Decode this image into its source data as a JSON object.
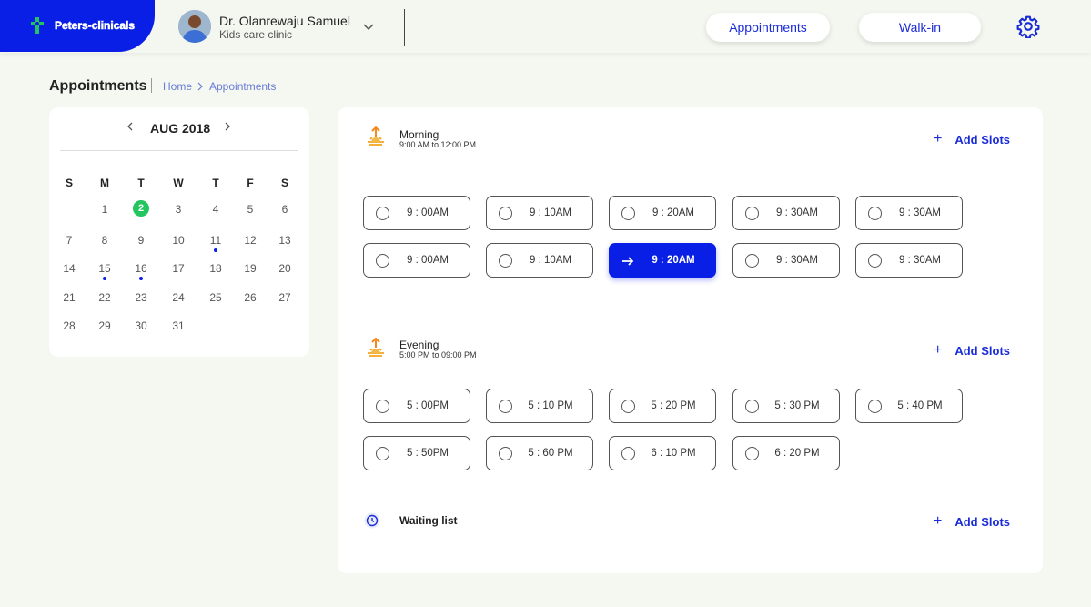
{
  "header": {
    "brand_name": "Peters-clinicals",
    "doctor_name": "Dr. Olanrewaju Samuel",
    "clinic_name": "Kids care clinic",
    "nav_appointments": "Appointments",
    "nav_walkin": "Walk-in",
    "brand_color": "#0a1fe6"
  },
  "page": {
    "title": "Appointments",
    "breadcrumb": [
      "Home",
      "Appointments"
    ]
  },
  "calendar": {
    "month": "AUG 2018",
    "weekdays": [
      "S",
      "M",
      "T",
      "W",
      "T",
      "F",
      "S"
    ],
    "weeks": [
      [
        "",
        "1",
        "2",
        "3",
        "4",
        "5",
        "6"
      ],
      [
        "7",
        "8",
        "9",
        "10",
        "11",
        "12",
        "13"
      ],
      [
        "14",
        "15",
        "16",
        "17",
        "18",
        "19",
        "20"
      ],
      [
        "21",
        "22",
        "23",
        "24",
        "25",
        "26",
        "27"
      ],
      [
        "28",
        "29",
        "30",
        "31",
        "",
        "",
        ""
      ]
    ],
    "selected_day": "2",
    "marked_days": [
      "11",
      "15",
      "16"
    ],
    "selected_color": "#22c55e"
  },
  "sections": {
    "morning": {
      "title": "Morning",
      "subtitle": "9:00 AM to 12:00 PM",
      "add_label": "Add Slots",
      "slots": [
        "9 : 00AM",
        "9 : 10AM",
        "9 : 20AM",
        "9 : 30AM",
        "9 : 30AM",
        "9 : 00AM",
        "9 : 10AM",
        "9 : 20AM",
        "9 : 30AM",
        "9 : 30AM"
      ],
      "active_index": 7
    },
    "evening": {
      "title": "Evening",
      "subtitle": "5:00 PM to 09:00 PM",
      "add_label": "Add Slots",
      "slots": [
        "5 : 00PM",
        "5 : 10 PM",
        "5 : 20 PM",
        "5 : 30 PM",
        "5 : 40 PM",
        "5 : 50PM",
        "5 : 60 PM",
        "6 : 10 PM",
        "6 : 20 PM"
      ]
    },
    "waiting": {
      "title": "Waiting list",
      "add_label": "Add Slots"
    }
  }
}
